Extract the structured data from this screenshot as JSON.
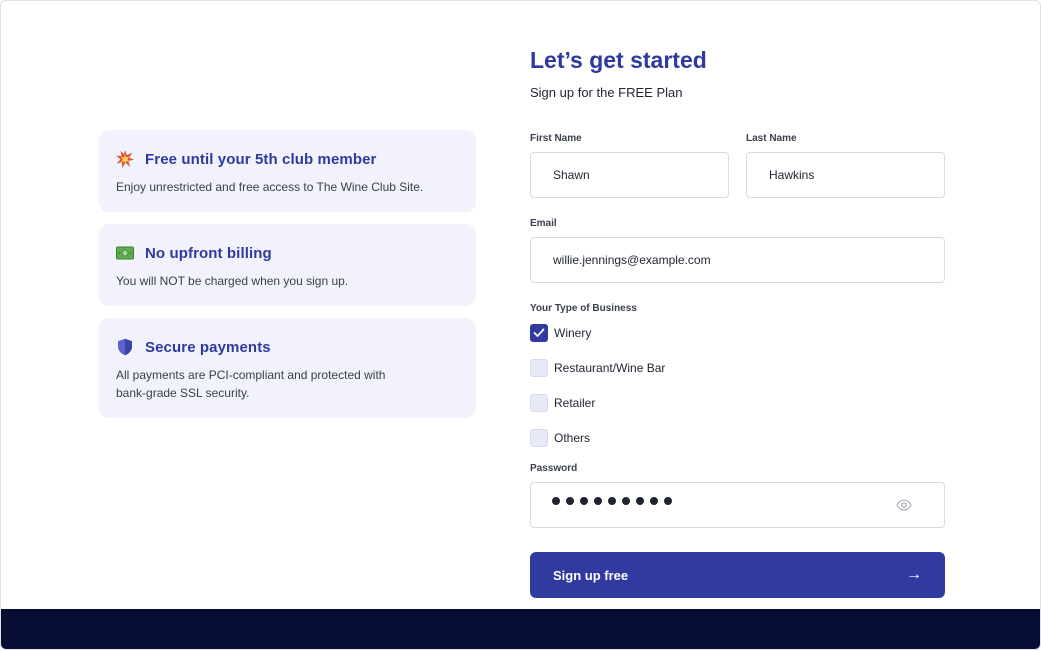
{
  "features": [
    {
      "icon": "explosion-icon",
      "title": "Free until your 5th club member",
      "description": "Enjoy unrestricted and free access to The Wine Club Site."
    },
    {
      "icon": "money-icon",
      "title": "No upfront billing",
      "description": "You will NOT be charged when you sign up."
    },
    {
      "icon": "shield-icon",
      "title": "Secure payments",
      "description": "All payments are PCI-compliant and protected with bank-grade SSL security."
    }
  ],
  "form": {
    "title": "Let’s get started",
    "subtitle": "Sign up for the FREE Plan",
    "first_name": {
      "label": "First Name",
      "value": "Shawn"
    },
    "last_name": {
      "label": "Last Name",
      "value": "Hawkins"
    },
    "email": {
      "label": "Email",
      "value": "willie.jennings@example.com"
    },
    "business_type": {
      "label": "Your Type of Business",
      "options": [
        {
          "label": "Winery",
          "checked": true
        },
        {
          "label": "Restaurant/Wine Bar",
          "checked": false
        },
        {
          "label": "Retailer",
          "checked": false
        },
        {
          "label": "Others",
          "checked": false
        }
      ]
    },
    "password": {
      "label": "Password",
      "masked_length": 9
    },
    "submit_label": "Sign up free",
    "submit_arrow": "→"
  },
  "colors": {
    "accent": "#313b9f",
    "heading": "#2f3aa0",
    "card_bg": "#f1f2fb",
    "footer": "#070d35"
  }
}
